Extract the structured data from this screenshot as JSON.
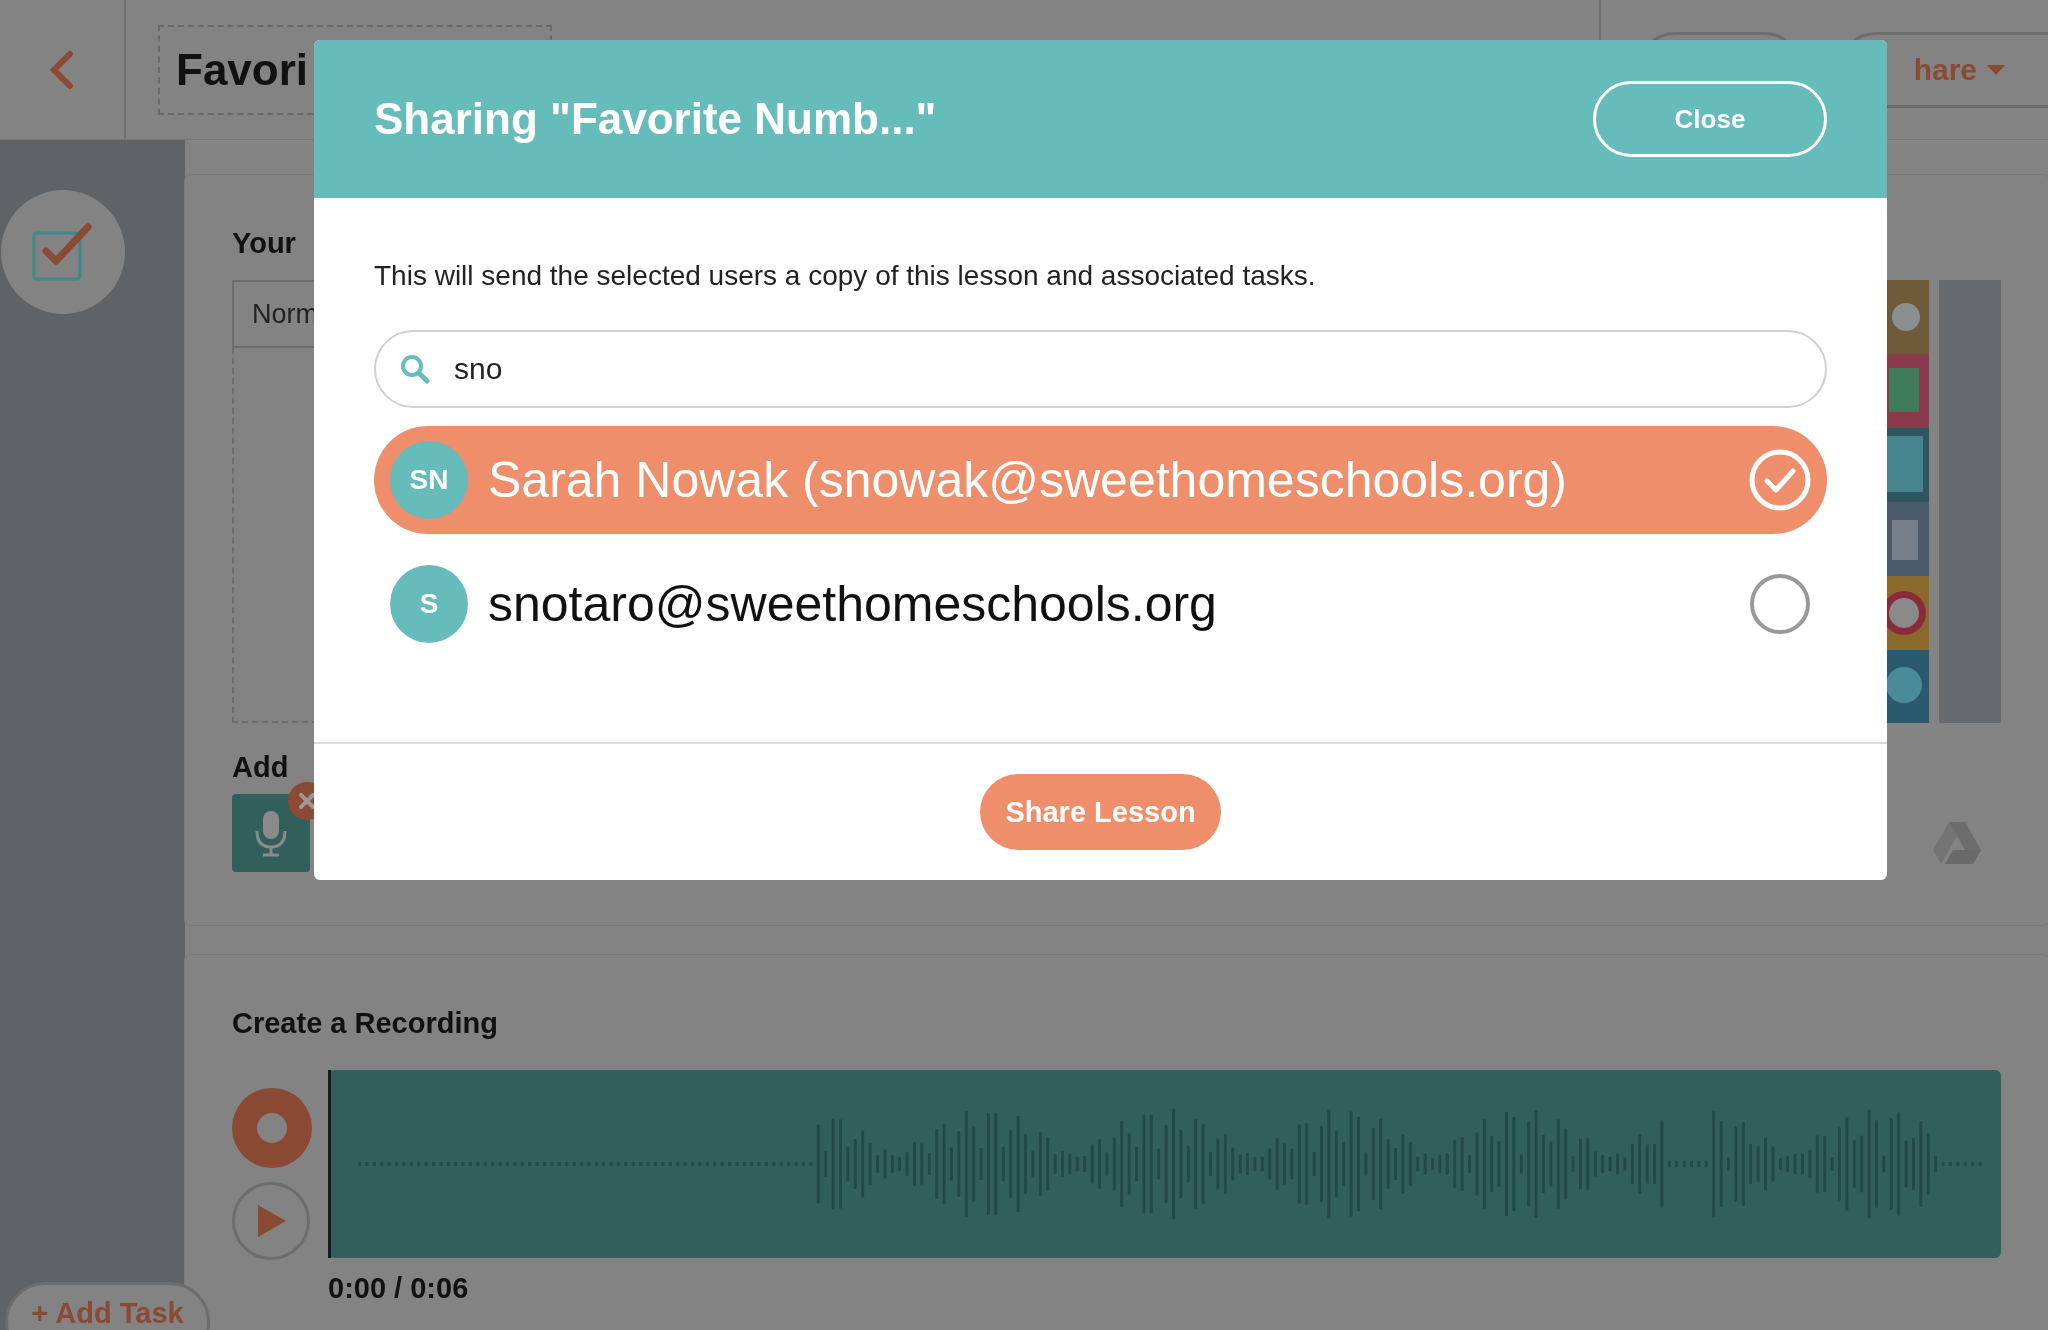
{
  "header": {
    "title_field": "Favori",
    "share_button": "hare"
  },
  "task_card": {
    "heading": "Your",
    "style_select": "Norm",
    "add_label": "Add"
  },
  "recording_card": {
    "heading": "Create a Recording",
    "time": "0:00 / 0:06"
  },
  "add_task_button": "+ Add Task",
  "dialog": {
    "title": "Sharing \"Favorite Numb...\"",
    "close_label": "Close",
    "description": "This will send the selected users a copy of this lesson and associated tasks.",
    "search": {
      "value": "sno"
    },
    "results": [
      {
        "initials": "SN",
        "label": "Sarah Nowak (snowak@sweethomeschools.org)",
        "selected": true
      },
      {
        "initials": "S",
        "label": "snotaro@sweethomeschools.org",
        "selected": false
      }
    ],
    "share_button": "Share Lesson"
  }
}
